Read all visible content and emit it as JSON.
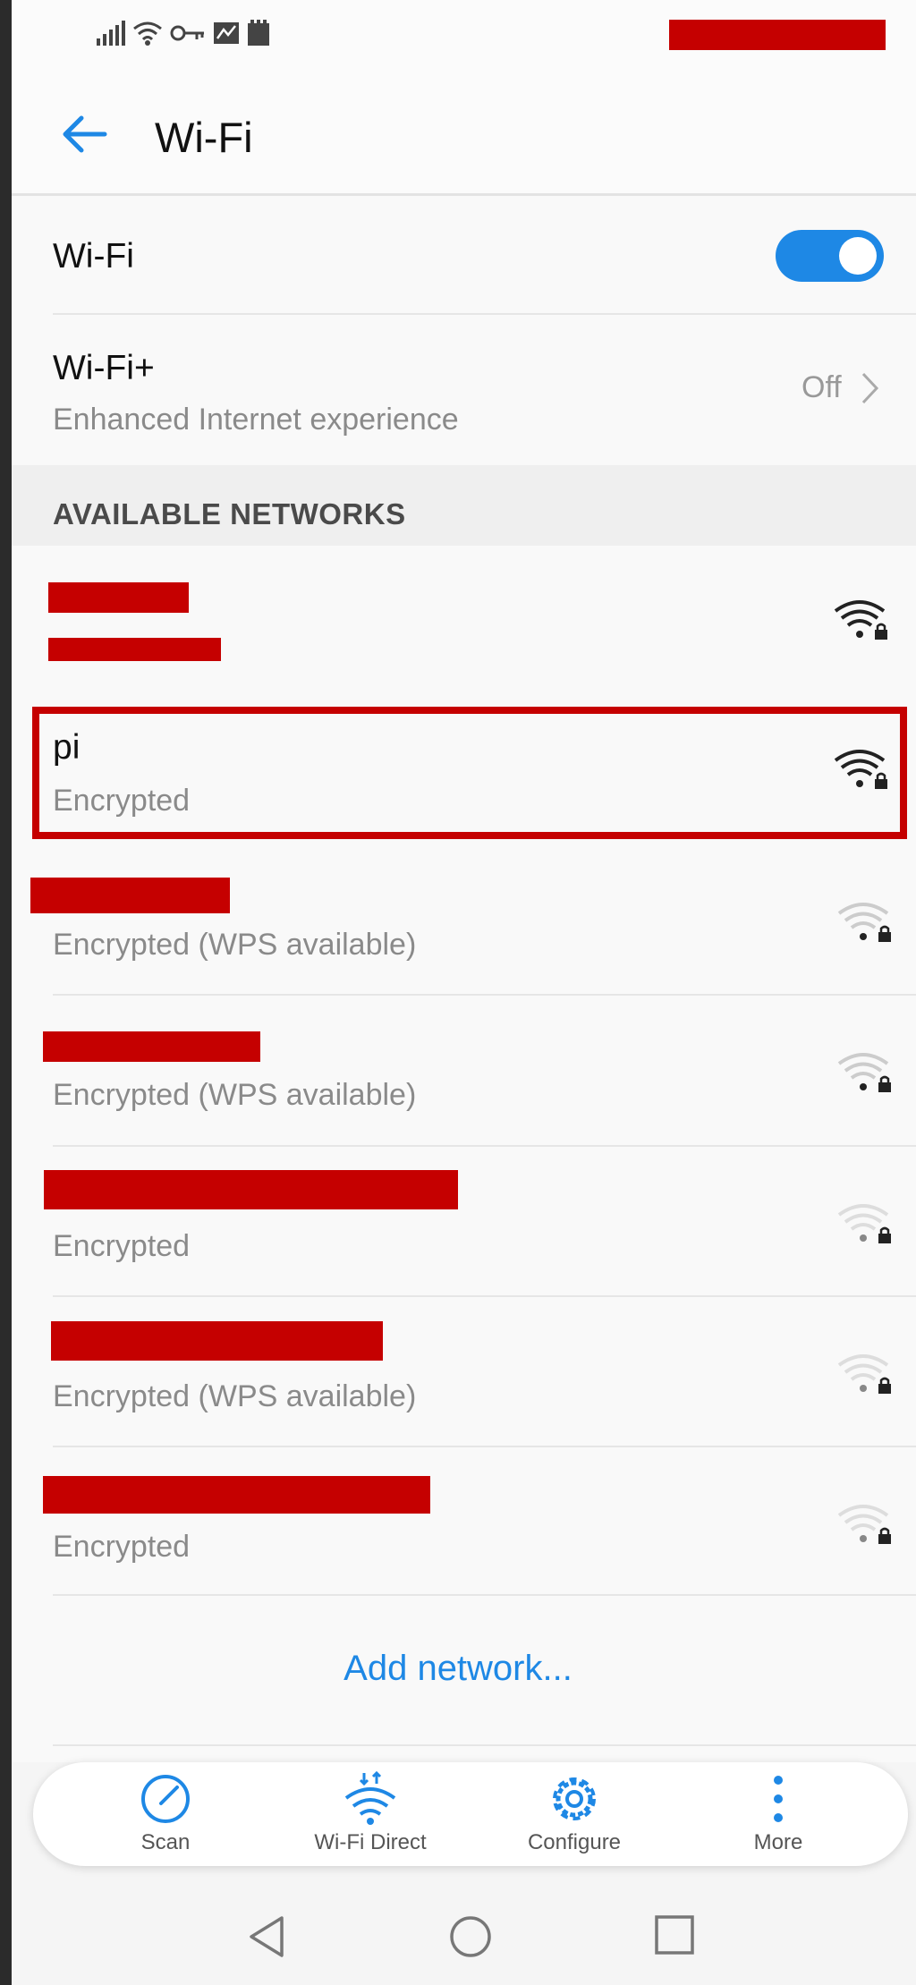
{
  "status_bar": {
    "icons": [
      "signal-icon",
      "wifi-icon",
      "key-icon",
      "data-icon",
      "battery-saver-icon"
    ]
  },
  "header": {
    "title": "Wi-Fi",
    "back_icon": "back-arrow-icon"
  },
  "wifi_toggle": {
    "label": "Wi-Fi",
    "state": "on",
    "accent_color": "#1e88e5"
  },
  "wifi_plus": {
    "label": "Wi-Fi+",
    "subtitle": "Enhanced Internet experience",
    "value": "Off"
  },
  "section_header": "AVAILABLE NETWORKS",
  "networks": [
    {
      "name": "",
      "status": "",
      "signal": "strong",
      "redacted": true
    },
    {
      "name": "pi",
      "status": "Encrypted",
      "signal": "strong",
      "redacted": false,
      "highlighted": true
    },
    {
      "name": "",
      "status": "Encrypted (WPS available)",
      "signal": "weak",
      "redacted": true
    },
    {
      "name": "",
      "status": "Encrypted (WPS available)",
      "signal": "weak",
      "redacted": true
    },
    {
      "name": "",
      "status": "Encrypted",
      "signal": "weak",
      "redacted": true
    },
    {
      "name": "",
      "status": "Encrypted (WPS available)",
      "signal": "weak",
      "redacted": true
    },
    {
      "name": "",
      "status": "Encrypted",
      "signal": "weak",
      "redacted": true
    }
  ],
  "add_network": "Add network...",
  "bottom_actions": [
    {
      "label": "Scan",
      "icon": "scan-icon"
    },
    {
      "label": "Wi-Fi Direct",
      "icon": "wifi-direct-icon"
    },
    {
      "label": "Configure",
      "icon": "gear-icon"
    },
    {
      "label": "More",
      "icon": "more-vertical-icon"
    }
  ],
  "nav_bar": [
    "back-icon",
    "home-icon",
    "recents-icon"
  ],
  "colors": {
    "redaction": "#c50000",
    "accent": "#1e88e5"
  }
}
